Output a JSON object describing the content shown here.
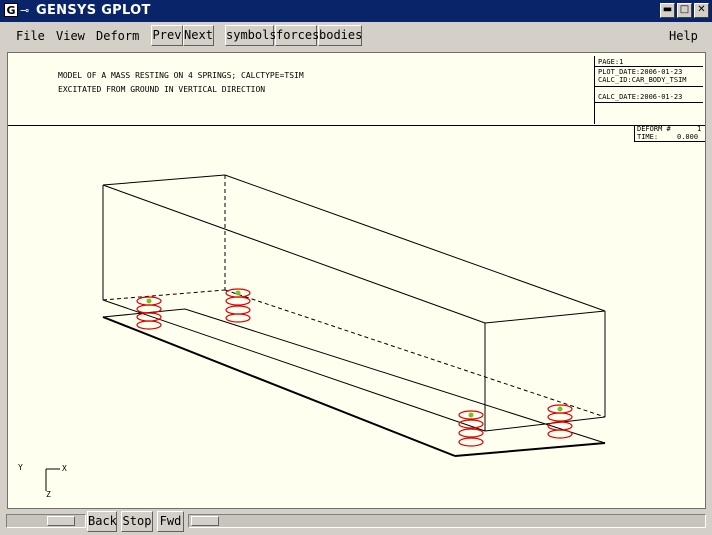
{
  "window": {
    "title": "GENSYS GPLOT",
    "app_icon": "G"
  },
  "menu": {
    "file": "File",
    "view": "View",
    "deform": "Deform",
    "help": "Help"
  },
  "toolbar": {
    "prev": "Prev",
    "next": "Next",
    "symbols": "symbols",
    "forces": "forces",
    "bodies": "bodies"
  },
  "plot": {
    "header_line1": "MODEL OF A MASS RESTING ON 4 SPRINGS; CALCTYPE=TSIM",
    "header_line2": "EXCITATED FROM GROUND IN VERTICAL DIRECTION",
    "page": "PAGE:1",
    "plot_date": "PLOT_DATE:2006-01-23",
    "calc_id": "CALC_ID:CAR_BODY_TSIM",
    "calc_date": "CALC_DATE:2006-01-23",
    "deform_label": "DEFORM #",
    "deform_value": "1",
    "time_label": "TIME:",
    "time_value": "0.000",
    "axis_y": "Y",
    "axis_x": "X",
    "axis_z": "Z",
    "colors": {
      "spring": "#e00000",
      "marker": "#7dc020",
      "lines": "#000000"
    }
  },
  "bottom": {
    "back": "Back",
    "stop": "Stop",
    "fwd": "Fwd"
  }
}
